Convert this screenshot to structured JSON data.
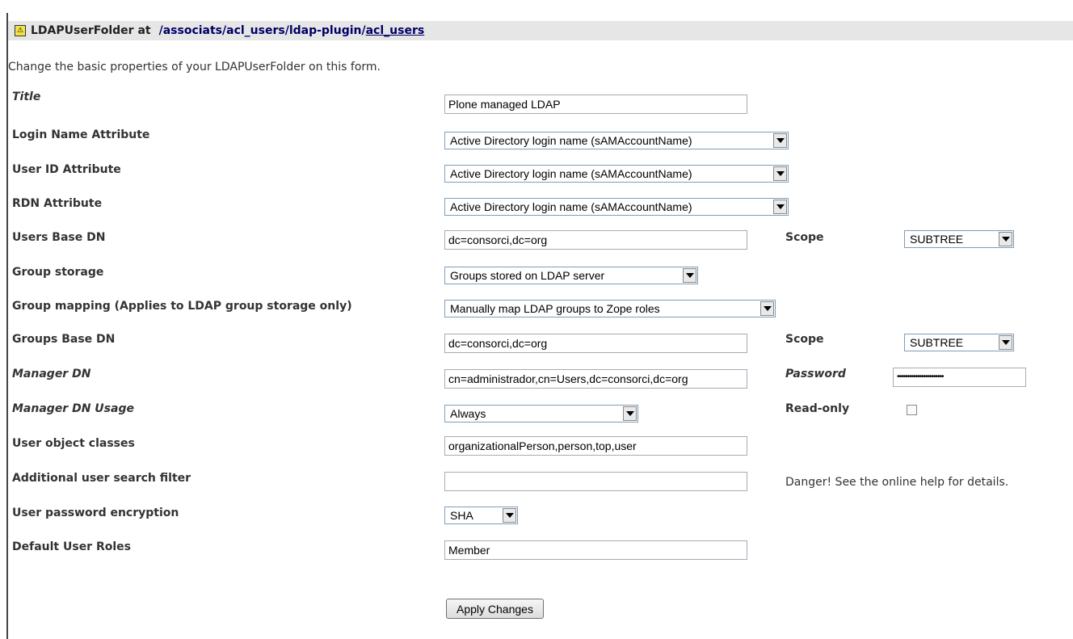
{
  "header": {
    "label": "LDAPUserFolder at",
    "path_prefix": "/associats/acl_users/ldap-plugin/",
    "path_link": "acl_users"
  },
  "intro": "Change the basic properties of your LDAPUserFolder on this form.",
  "fields": {
    "title": {
      "label": "Title",
      "value": "Plone managed LDAP"
    },
    "login_name_attribute": {
      "label": "Login Name Attribute",
      "value": "Active Directory login name (sAMAccountName)"
    },
    "user_id_attribute": {
      "label": "User ID Attribute",
      "value": "Active Directory login name (sAMAccountName)"
    },
    "rdn_attribute": {
      "label": "RDN Attribute",
      "value": "Active Directory login name (sAMAccountName)"
    },
    "users_base_dn": {
      "label": "Users Base DN",
      "value": "dc=consorci,dc=org",
      "scope_label": "Scope",
      "scope_value": "SUBTREE"
    },
    "group_storage": {
      "label": "Group storage",
      "value": "Groups stored on LDAP server"
    },
    "group_mapping": {
      "label": "Group mapping (Applies to LDAP group storage only)",
      "value": "Manually map LDAP groups to Zope roles"
    },
    "groups_base_dn": {
      "label": "Groups Base DN",
      "value": "dc=consorci,dc=org",
      "scope_label": "Scope",
      "scope_value": "SUBTREE"
    },
    "manager_dn": {
      "label": "Manager DN",
      "value": "cn=administrador,cn=Users,dc=consorci,dc=org",
      "password_label": "Password",
      "password_value": "•••••••••••••••••••••••"
    },
    "manager_dn_usage": {
      "label": "Manager DN Usage",
      "value": "Always",
      "readonly_label": "Read-only"
    },
    "user_object_classes": {
      "label": "User object classes",
      "value": "organizationalPerson,person,top,user"
    },
    "additional_filter": {
      "label": "Additional user search filter",
      "value": "",
      "note": "Danger! See the online help for details."
    },
    "password_encryption": {
      "label": "User password encryption",
      "value": "SHA"
    },
    "default_user_roles": {
      "label": "Default User Roles",
      "value": "Member"
    }
  },
  "apply_button": "Apply Changes",
  "colors": {
    "header_bg": "#e6e6e6",
    "link": "#000066",
    "icon": "#f2e24a"
  }
}
